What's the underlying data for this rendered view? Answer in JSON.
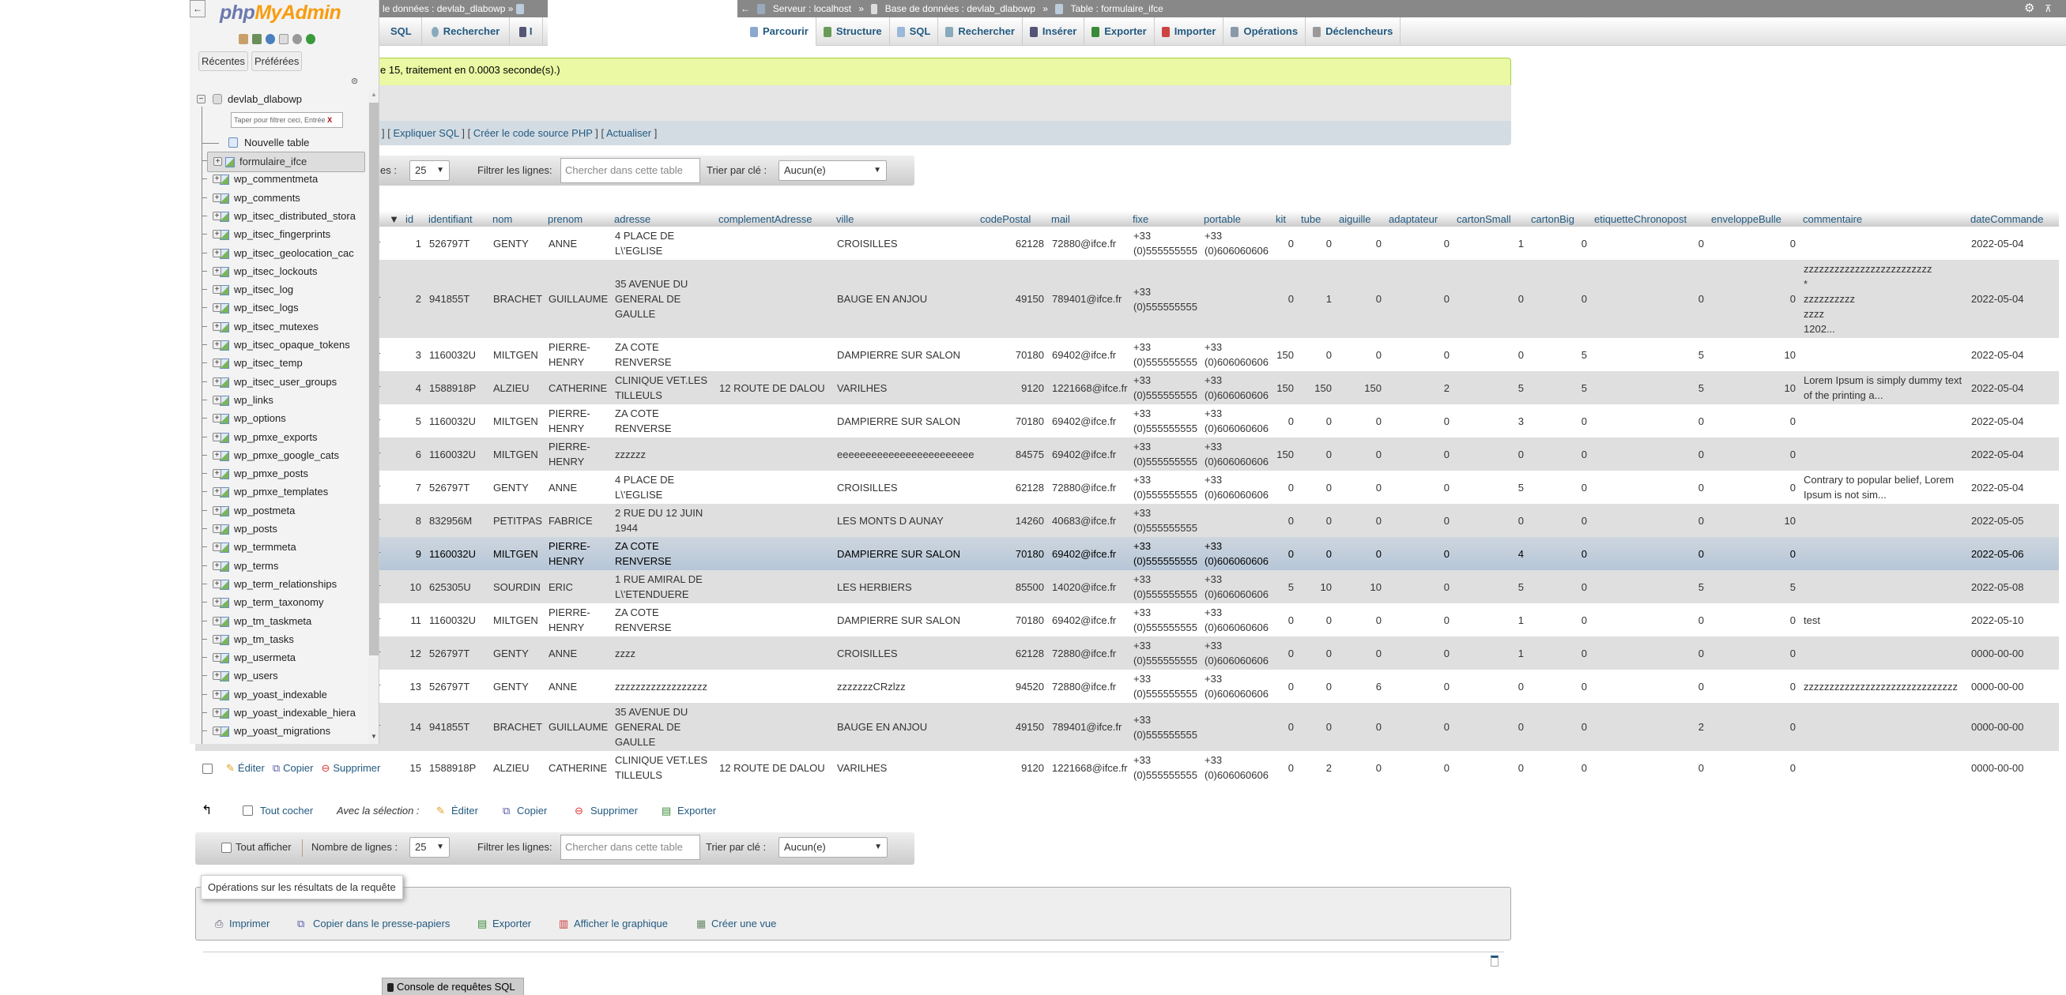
{
  "sidebar": {
    "back": "←",
    "logo_php": "php",
    "logo_myadmin": "MyAdmin",
    "icons": [
      "home-icon",
      "logout-icon",
      "help-icon",
      "docs-icon",
      "settings-icon",
      "reload-icon"
    ],
    "tabs": [
      "Récentes",
      "Préférées"
    ],
    "database": "devlab_dlabowp",
    "filter_placeholder": "Taper pour filtrer ceci, Entrée",
    "filter_clear": "X",
    "new_table": "Nouvelle table",
    "selected_table": "formulaire_ifce",
    "tables": [
      "formulaire_ifce",
      "wp_commentmeta",
      "wp_comments",
      "wp_itsec_distributed_stora",
      "wp_itsec_fingerprints",
      "wp_itsec_geolocation_cac",
      "wp_itsec_lockouts",
      "wp_itsec_log",
      "wp_itsec_logs",
      "wp_itsec_mutexes",
      "wp_itsec_opaque_tokens",
      "wp_itsec_temp",
      "wp_itsec_user_groups",
      "wp_links",
      "wp_options",
      "wp_pmxe_exports",
      "wp_pmxe_google_cats",
      "wp_pmxe_posts",
      "wp_pmxe_templates",
      "wp_postmeta",
      "wp_posts",
      "wp_termmeta",
      "wp_terms",
      "wp_term_relationships",
      "wp_term_taxonomy",
      "wp_tm_taskmeta",
      "wp_tm_tasks",
      "wp_usermeta",
      "wp_users",
      "wp_yoast_indexable",
      "wp_yoast_indexable_hiera",
      "wp_yoast_migrations"
    ]
  },
  "old_panel": {
    "breadcrumb": "le données : devlab_dlabowp  »",
    "tabs": [
      "SQL",
      "Rechercher",
      "I"
    ]
  },
  "breadcrumb": {
    "back": "←",
    "server": "Serveur : localhost",
    "database": "Base de données : devlab_dlabowp",
    "table": "Table : formulaire_ifce",
    "separator": "»",
    "settings_icon": "⚙",
    "collapse_icon": "⊼"
  },
  "tabs": [
    {
      "label": "Parcourir",
      "icon": "browse-icon",
      "active": true
    },
    {
      "label": "Structure",
      "icon": "structure-icon"
    },
    {
      "label": "SQL",
      "icon": "sql-icon"
    },
    {
      "label": "Rechercher",
      "icon": "search-icon"
    },
    {
      "label": "Insérer",
      "icon": "insert-icon"
    },
    {
      "label": "Exporter",
      "icon": "export-icon"
    },
    {
      "label": "Importer",
      "icon": "import-icon"
    },
    {
      "label": "Opérations",
      "icon": "operations-icon"
    },
    {
      "label": "Déclencheurs",
      "icon": "triggers-icon"
    }
  ],
  "message": "e 15, traitement en 0.0003 seconde(s).)",
  "sql_links": {
    "lead": "]",
    "explain": "Expliquer SQL",
    "php": "Créer le code source PHP",
    "refresh": "Actualiser"
  },
  "nav_top": {
    "rows_label": "es :",
    "rows_value": "25",
    "filter_label": "Filtrer les lignes:",
    "filter_placeholder": "Chercher dans cette table",
    "sort_label": "Trier par clé :",
    "sort_value": "Aucun(e)"
  },
  "table": {
    "sort_arrow": "▼",
    "actions": {
      "edit": "Éditer",
      "copy": "Copier",
      "delete": "Supprimer"
    },
    "columns": [
      "id",
      "identifiant",
      "nom",
      "prenom",
      "adresse",
      "complementAdresse",
      "ville",
      "codePostal",
      "mail",
      "fixe",
      "portable",
      "kit",
      "tube",
      "aiguille",
      "adaptateur",
      "cartonSmall",
      "cartonBig",
      "etiquetteChronopost",
      "enveloppeBulle",
      "commentaire",
      "dateCommande"
    ],
    "marked_row": 9,
    "rows": [
      [
        "1",
        "526797T",
        "GENTY",
        "ANNE",
        "4 PLACE DE\nL\\'EGLISE",
        "",
        "CROISILLES",
        "62128",
        "72880@ifce.fr",
        "+33\n(0)555555555",
        "+33\n(0)606060606",
        "0",
        "0",
        "0",
        "0",
        "1",
        "0",
        "0",
        "0",
        "",
        "2022-05-04"
      ],
      [
        "2",
        "941855T",
        "BRACHET",
        "GUILLAUME",
        "35 AVENUE DU\nGENERAL DE\nGAULLE",
        "",
        "BAUGE EN ANJOU",
        "49150",
        "789401@ifce.fr",
        "+33\n(0)555555555",
        "",
        "0",
        "1",
        "0",
        "0",
        "0",
        "0",
        "0",
        "0",
        "zzzzzzzzzzzzzzzzzzzzzzzzz\n*\nzzzzzzzzzz\nzzzz\n1202...",
        "2022-05-04"
      ],
      [
        "3",
        "1160032U",
        "MILTGEN",
        "PIERRE-\nHENRY",
        "ZA COTE\nRENVERSE",
        "",
        "DAMPIERRE SUR SALON",
        "70180",
        "69402@ifce.fr",
        "+33\n(0)555555555",
        "+33\n(0)606060606",
        "150",
        "0",
        "0",
        "0",
        "0",
        "5",
        "5",
        "10",
        "",
        "2022-05-04"
      ],
      [
        "4",
        "1588918P",
        "ALZIEU",
        "CATHERINE",
        "CLINIQUE VET.LES\nTILLEULS",
        "12 ROUTE DE DALOU",
        "VARILHES",
        "9120",
        "1221668@ifce.fr",
        "+33\n(0)555555555",
        "+33\n(0)606060606",
        "150",
        "150",
        "150",
        "2",
        "5",
        "5",
        "5",
        "10",
        "Lorem Ipsum is simply dummy text\nof the printing a...",
        "2022-05-04"
      ],
      [
        "5",
        "1160032U",
        "MILTGEN",
        "PIERRE-\nHENRY",
        "ZA COTE\nRENVERSE",
        "",
        "DAMPIERRE SUR SALON",
        "70180",
        "69402@ifce.fr",
        "+33\n(0)555555555",
        "+33\n(0)606060606",
        "0",
        "0",
        "0",
        "0",
        "3",
        "0",
        "0",
        "0",
        "",
        "2022-05-04"
      ],
      [
        "6",
        "1160032U",
        "MILTGEN",
        "PIERRE-\nHENRY",
        "zzzzzz",
        "",
        "eeeeeeeeeeeeeeeeeeeeeeee",
        "84575",
        "69402@ifce.fr",
        "+33\n(0)555555555",
        "+33\n(0)606060606",
        "150",
        "0",
        "0",
        "0",
        "0",
        "0",
        "0",
        "0",
        "",
        "2022-05-04"
      ],
      [
        "7",
        "526797T",
        "GENTY",
        "ANNE",
        "4 PLACE DE\nL\\'EGLISE",
        "",
        "CROISILLES",
        "62128",
        "72880@ifce.fr",
        "+33\n(0)555555555",
        "+33\n(0)606060606",
        "0",
        "0",
        "0",
        "0",
        "5",
        "0",
        "0",
        "0",
        "Contrary to popular belief, Lorem\nIpsum is not sim...",
        "2022-05-04"
      ],
      [
        "8",
        "832956M",
        "PETITPAS",
        "FABRICE",
        "2 RUE DU 12 JUIN\n1944",
        "",
        "LES MONTS D AUNAY",
        "14260",
        "40683@ifce.fr",
        "+33\n(0)555555555",
        "",
        "0",
        "0",
        "0",
        "0",
        "0",
        "0",
        "0",
        "10",
        "",
        "2022-05-05"
      ],
      [
        "9",
        "1160032U",
        "MILTGEN",
        "PIERRE-\nHENRY",
        "ZA COTE\nRENVERSE",
        "",
        "DAMPIERRE SUR SALON",
        "70180",
        "69402@ifce.fr",
        "+33\n(0)555555555",
        "+33\n(0)606060606",
        "0",
        "0",
        "0",
        "0",
        "4",
        "0",
        "0",
        "0",
        "",
        "2022-05-06"
      ],
      [
        "10",
        "625305U",
        "SOURDIN",
        "ERIC",
        "1 RUE AMIRAL DE\nL\\'ETENDUERE",
        "",
        "LES HERBIERS",
        "85500",
        "14020@ifce.fr",
        "+33\n(0)555555555",
        "+33\n(0)606060606",
        "5",
        "10",
        "10",
        "0",
        "5",
        "0",
        "5",
        "5",
        "",
        "2022-05-08"
      ],
      [
        "11",
        "1160032U",
        "MILTGEN",
        "PIERRE-\nHENRY",
        "ZA COTE\nRENVERSE",
        "",
        "DAMPIERRE SUR SALON",
        "70180",
        "69402@ifce.fr",
        "+33\n(0)555555555",
        "+33\n(0)606060606",
        "0",
        "0",
        "0",
        "0",
        "1",
        "0",
        "0",
        "0",
        "test",
        "2022-05-10"
      ],
      [
        "12",
        "526797T",
        "GENTY",
        "ANNE",
        "zzzz",
        "",
        "CROISILLES",
        "62128",
        "72880@ifce.fr",
        "+33\n(0)555555555",
        "+33\n(0)606060606",
        "0",
        "0",
        "0",
        "0",
        "1",
        "0",
        "0",
        "0",
        "",
        "0000-00-00"
      ],
      [
        "13",
        "526797T",
        "GENTY",
        "ANNE",
        "zzzzzzzzzzzzzzzzzz",
        "",
        "zzzzzzzCRzlzz",
        "94520",
        "72880@ifce.fr",
        "+33\n(0)555555555",
        "+33\n(0)606060606",
        "0",
        "0",
        "6",
        "0",
        "0",
        "0",
        "0",
        "0",
        "zzzzzzzzzzzzzzzzzzzzzzzzzzzzzz",
        "0000-00-00"
      ],
      [
        "14",
        "941855T",
        "BRACHET",
        "GUILLAUME",
        "35 AVENUE DU\nGENERAL DE\nGAULLE",
        "",
        "BAUGE EN ANJOU",
        "49150",
        "789401@ifce.fr",
        "+33\n(0)555555555",
        "",
        "0",
        "0",
        "0",
        "0",
        "0",
        "0",
        "2",
        "0",
        "",
        "0000-00-00"
      ],
      [
        "15",
        "1588918P",
        "ALZIEU",
        "CATHERINE",
        "CLINIQUE VET.LES\nTILLEULS",
        "12 ROUTE DE DALOU",
        "VARILHES",
        "9120",
        "1221668@ifce.fr",
        "+33\n(0)555555555",
        "+33\n(0)606060606",
        "0",
        "2",
        "0",
        "0",
        "0",
        "0",
        "0",
        "0",
        "",
        "0000-00-00"
      ]
    ]
  },
  "bulk": {
    "check_all": "Tout cocher",
    "with_selection": "Avec la sélection :",
    "edit": "Éditer",
    "copy": "Copier",
    "delete": "Supprimer",
    "export": "Exporter"
  },
  "nav_bottom": {
    "show_all": "Tout afficher",
    "rows_label": "Nombre de lignes :",
    "rows_value": "25",
    "filter_label": "Filtrer les lignes:",
    "filter_placeholder": "Chercher dans cette table",
    "sort_label": "Trier par clé :",
    "sort_value": "Aucun(e)"
  },
  "operations": {
    "legend": "Opérations sur les résultats de la requête",
    "print": "Imprimer",
    "copy_clipboard": "Copier dans le presse-papiers",
    "export": "Exporter",
    "chart": "Afficher le graphique",
    "create_view": "Créer une vue"
  },
  "console": "Console de requêtes SQL",
  "colors": {
    "link": "#235a81",
    "success_bg": "#ebf8a4",
    "marked_row": "#c1cfdc",
    "logo_php": "#6c78af",
    "logo_myadmin": "#f89c0e"
  }
}
